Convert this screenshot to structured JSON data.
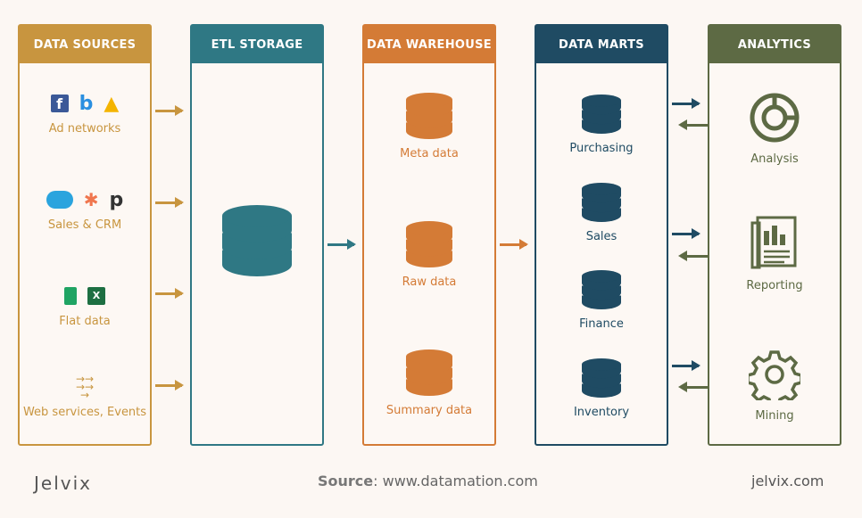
{
  "colors": {
    "sources": "#c8953f",
    "etl": "#2f7884",
    "warehouse": "#d47b36",
    "marts": "#1f4b63",
    "analytics": "#5d6a44"
  },
  "columns": {
    "sources": {
      "title": "DATA SOURCES",
      "items": [
        "Ad networks",
        "Sales & CRM",
        "Flat data",
        "Web services, Events"
      ]
    },
    "etl": {
      "title": "ETL STORAGE"
    },
    "warehouse": {
      "title": "DATA WAREHOUSE",
      "items": [
        "Meta data",
        "Raw data",
        "Summary data"
      ]
    },
    "marts": {
      "title": "DATA MARTS",
      "items": [
        "Purchasing",
        "Sales",
        "Finance",
        "Inventory"
      ]
    },
    "analytics": {
      "title": "ANALYTICS",
      "items": [
        "Analysis",
        "Reporting",
        "Mining"
      ]
    }
  },
  "footer": {
    "brand": "Jelvix",
    "source_label": "Source",
    "source_value": ": www.datamation.com",
    "site": "jelvix.com"
  }
}
